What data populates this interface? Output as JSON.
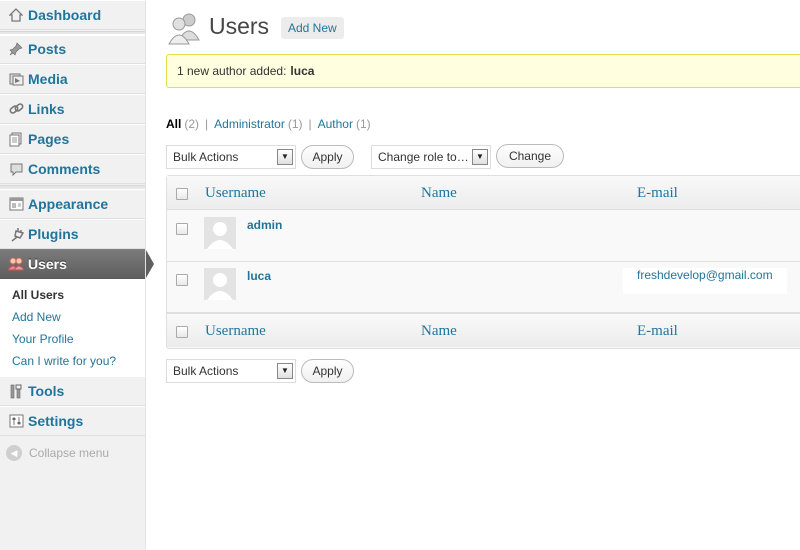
{
  "sidebar": {
    "items": [
      {
        "label": "Dashboard",
        "icon": "dashboard-icon"
      },
      {
        "label": "Posts",
        "icon": "pushpin-icon"
      },
      {
        "label": "Media",
        "icon": "media-icon"
      },
      {
        "label": "Links",
        "icon": "link-icon"
      },
      {
        "label": "Pages",
        "icon": "pages-icon"
      },
      {
        "label": "Comments",
        "icon": "comment-icon"
      },
      {
        "label": "Appearance",
        "icon": "appearance-icon"
      },
      {
        "label": "Plugins",
        "icon": "plugin-icon"
      },
      {
        "label": "Users",
        "icon": "users-icon"
      },
      {
        "label": "Tools",
        "icon": "tools-icon"
      },
      {
        "label": "Settings",
        "icon": "settings-icon"
      }
    ],
    "submenu": [
      {
        "label": "All Users"
      },
      {
        "label": "Add New"
      },
      {
        "label": "Your Profile"
      },
      {
        "label": "Can I write for you?"
      }
    ],
    "collapse_label": "Collapse menu"
  },
  "header": {
    "title": "Users",
    "add_new_label": "Add New"
  },
  "notice": {
    "text": "1 new author added:",
    "name": "luca"
  },
  "views": [
    {
      "label": "All",
      "count": "(2)"
    },
    {
      "label": "Administrator",
      "count": "(1)"
    },
    {
      "label": "Author",
      "count": "(1)"
    }
  ],
  "views_separator": "|",
  "bulk_actions": {
    "selected": "Bulk Actions",
    "apply_label": "Apply"
  },
  "change_role": {
    "selected": "Change role to…",
    "change_label": "Change"
  },
  "table": {
    "columns": [
      "Username",
      "Name",
      "E-mail"
    ],
    "rows": [
      {
        "username": "admin",
        "name": "",
        "email": ""
      },
      {
        "username": "luca",
        "name": "",
        "email": "freshdevelop@gmail.com"
      }
    ]
  },
  "colors": {
    "link": "#21759b",
    "notice_bg": "#ffffe0",
    "notice_border": "#e6db55",
    "current_menu": "#6d6d6d"
  }
}
